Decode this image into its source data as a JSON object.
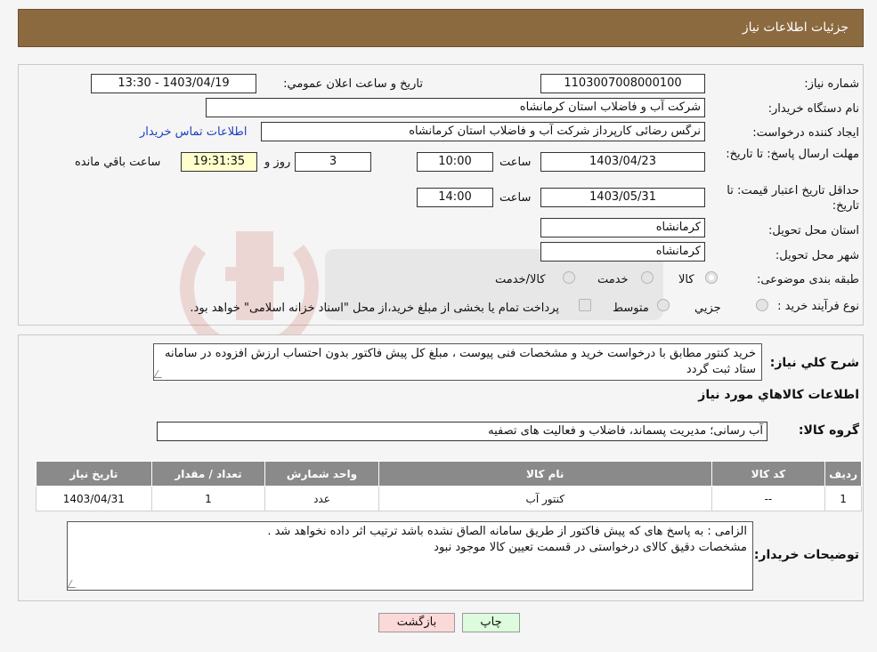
{
  "header": {
    "title": "جزئيات اطلاعات نياز"
  },
  "fields": {
    "need_number": {
      "label": "شماره نياز:",
      "value": "1103007008000100"
    },
    "announce": {
      "label": "تاريخ و ساعت اعلان عمومي:",
      "value": "1403/04/19 - 13:30"
    },
    "buyer_org": {
      "label": "نام دستگاه خريدار:",
      "value": "شرکت آب و فاضلاب استان کرمانشاه"
    },
    "requester": {
      "label": "ايجاد کننده درخواست:",
      "value": "نرگس رضائی کارپرداز شرکت آب و فاضلاب استان کرمانشاه"
    },
    "contact_link": "اطلاعات تماس خريدار",
    "deadline": {
      "label": "مهلت ارسال پاسخ: تا تاريخ:",
      "date": "1403/04/23",
      "time_label": "ساعت",
      "time": "10:00",
      "days": "3",
      "days_label": "روز و",
      "remaining": "19:31:35",
      "remaining_label": "ساعت باقي مانده"
    },
    "validity": {
      "label": "حداقل تاريخ اعتبار قيمت: تا تاريخ:",
      "date": "1403/05/31",
      "time_label": "ساعت",
      "time": "14:00"
    },
    "province": {
      "label": "استان محل تحويل:",
      "value": "کرمانشاه"
    },
    "city": {
      "label": "شهر محل تحويل:",
      "value": "کرمانشاه"
    },
    "category": {
      "label": "طبقه بندی موضوعی:",
      "options": [
        "کالا",
        "خدمت",
        "کالا/خدمت"
      ]
    },
    "purchase_type": {
      "label": "نوع فرآيند خريد :",
      "options": [
        "جزيي",
        "متوسط"
      ],
      "note": "پرداخت تمام یا بخشی از مبلغ خرید،از محل \"اسناد خزانه اسلامی\" خواهد بود."
    }
  },
  "summary": {
    "label": "شرح کلي نياز:",
    "text": "خرید کنتور مطابق با درخواست خرید و مشخصات فنی پیوست ، مبلغ کل پیش فاکتور بدون احتساب ارزش افزوده در سامانه ستاد ثبت گردد"
  },
  "goods_section_title": "اطلاعات کالاهاي مورد نياز",
  "goods_group": {
    "label": "گروه کالا:",
    "value": "آب رسانی؛ مدیریت پسماند، فاضلاب و فعالیت های تصفیه"
  },
  "table": {
    "headers": [
      "رديف",
      "کد کالا",
      "نام کالا",
      "واحد شمارش",
      "تعداد / مقدار",
      "تاريخ نياز"
    ],
    "rows": [
      [
        "1",
        "--",
        "کنتور آب",
        "عدد",
        "1",
        "1403/04/31"
      ]
    ]
  },
  "buyer_notes": {
    "label": "توضيحات خريدار:",
    "line1": "الزامی : به پاسخ های که پیش فاکتور از طریق سامانه الصاق نشده باشد ترتیب اثر داده نخواهد شد .",
    "line2": "مشخصات دقیق کالای درخواستی در قسمت تعیین کالا موجود نبود"
  },
  "buttons": {
    "print": "چاپ",
    "back": "بازگشت"
  },
  "colors": {
    "header_bg": "#8c6a3f",
    "table_header_bg": "#8a8a8a",
    "link": "#1c3fbf"
  }
}
